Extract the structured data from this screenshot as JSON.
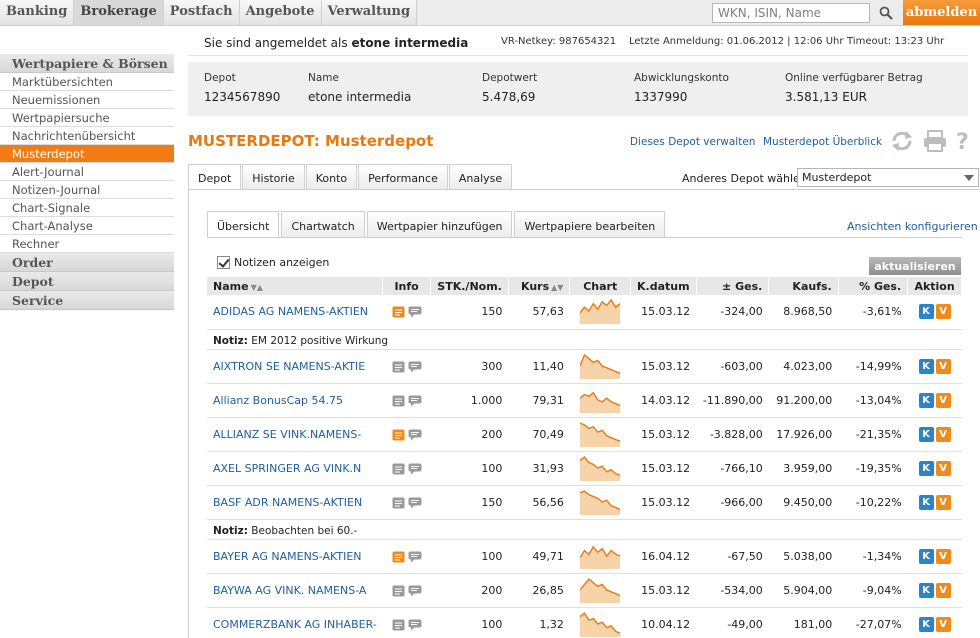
{
  "topnav": {
    "tabs": [
      "Banking",
      "Brokerage",
      "Postfach",
      "Angebote",
      "Verwaltung"
    ],
    "active_index": 1,
    "search_placeholder": "WKN, ISIN, Name",
    "logout_label": "abmelden",
    "accent_color": "#e9780f"
  },
  "sidebar": {
    "section_title": "Wertpapiere & Börsen",
    "items": [
      "Marktübersichten",
      "Neuemissionen",
      "Wertpapiersuche",
      "Nachrichtenübersicht",
      "Musterdepot",
      "Alert-Journal",
      "Notizen-Journal",
      "Chart-Signale",
      "Chart-Analyse",
      "Rechner"
    ],
    "active_index": 4,
    "sections": [
      "Order",
      "Depot",
      "Service"
    ]
  },
  "user": {
    "login_prefix": "Sie sind angemeldet als",
    "login_name": "etone intermedia",
    "netkey": "VR-Netkey: 987654321",
    "last_login": "Letzte Anmeldung: 01.06.2012 | 12:06 Uhr",
    "timeout": "Timeout: 13:23 Uhr"
  },
  "depot_info": {
    "depot_label": "Depot",
    "depot_value": "1234567890",
    "name_label": "Name",
    "name_value": "etone intermedia",
    "depotwert_label": "Depotwert",
    "depotwert_value": "5.478,69",
    "konto_label": "Abwicklungskonto",
    "konto_value": "1337990",
    "betrag_label": "Online verfügbarer Betrag",
    "betrag_value": "3.581,13 EUR"
  },
  "page": {
    "title": "MUSTERDEPOT: Musterdepot",
    "manage_link": "Dieses Depot verwalten",
    "overview_link": "Musterdepot Überblick"
  },
  "tabs_main": [
    "Depot",
    "Historie",
    "Konto",
    "Performance",
    "Analyse"
  ],
  "depot_select": {
    "label": "Anderes Depot wählen:",
    "value": "Musterdepot"
  },
  "tabs_sub": [
    "Übersicht",
    "Chartwatch",
    "Wertpapier hinzufügen",
    "Wertpapiere bearbeiten"
  ],
  "config_link": "Ansichten konfigurieren",
  "notes_toggle_label": "Notizen anzeigen",
  "refresh_label": "aktualisieren",
  "table": {
    "headers": {
      "name": "Name",
      "info": "Info",
      "stk": "STK./Nom.",
      "kurs": "Kurs",
      "chart": "Chart",
      "kdatum": "K.datum",
      "ges": "± Ges.",
      "kaufs": "Kaufs.",
      "pges": "% Ges.",
      "aktion": "Aktion"
    },
    "note_prefix": "Notiz:",
    "action_k": "K",
    "action_v": "V",
    "rows": [
      {
        "name": "ADIDAS AG NAMENS-AKTIEN",
        "stk": "150",
        "kurs": "57,63",
        "kdatum": "15.03.12",
        "ges": "-324,00",
        "kaufs": "8.968,50",
        "pges": "-3,61%",
        "info_orange": true,
        "trend": [
          5,
          8,
          6,
          10,
          7,
          11,
          9,
          12,
          8,
          10
        ],
        "note": "EM 2012 positive Wirkung"
      },
      {
        "name": "AIXTRON SE NAMENS-AKTIE",
        "stk": "300",
        "kurs": "11,40",
        "kdatum": "15.03.12",
        "ges": "-603,00",
        "kaufs": "4.023,00",
        "pges": "-14,99%",
        "info_orange": false,
        "trend": [
          6,
          12,
          10,
          8,
          9,
          6,
          5,
          4,
          3,
          2
        ]
      },
      {
        "name": "Allianz BonusCap 54.75",
        "stk": "1.000",
        "kurs": "79,31",
        "kdatum": "14.03.12",
        "ges": "-11.890,00",
        "kaufs": "91.200,00",
        "pges": "-13,04%",
        "info_orange": false,
        "trend": [
          7,
          9,
          8,
          10,
          6,
          5,
          7,
          5,
          4,
          3
        ]
      },
      {
        "name": "ALLIANZ SE VINK.NAMENS-",
        "stk": "200",
        "kurs": "70,49",
        "kdatum": "15.03.12",
        "ges": "-3.828,00",
        "kaufs": "17.926,00",
        "pges": "-21,35%",
        "info_orange": true,
        "trend": [
          12,
          11,
          9,
          10,
          7,
          8,
          5,
          4,
          3,
          2
        ]
      },
      {
        "name": "AXEL SPRINGER AG VINK.N",
        "stk": "100",
        "kurs": "31,93",
        "kdatum": "15.03.12",
        "ges": "-766,10",
        "kaufs": "3.959,00",
        "pges": "-19,35%",
        "info_orange": false,
        "trend": [
          10,
          12,
          9,
          8,
          6,
          7,
          4,
          5,
          3,
          2
        ]
      },
      {
        "name": "BASF ADR NAMENS-AKTIEN",
        "stk": "150",
        "kurs": "56,56",
        "kdatum": "15.03.12",
        "ges": "-966,00",
        "kaufs": "9.450,00",
        "pges": "-10,22%",
        "info_orange": false,
        "trend": [
          11,
          12,
          10,
          9,
          8,
          6,
          7,
          4,
          3,
          2
        ],
        "note": "Beobachten bei 60.-"
      },
      {
        "name": "BAYER AG NAMENS-AKTIEN",
        "stk": "100",
        "kurs": "49,71",
        "kdatum": "16.04.12",
        "ges": "-67,50",
        "kaufs": "5.038,00",
        "pges": "-1,34%",
        "info_orange": true,
        "trend": [
          5,
          9,
          7,
          11,
          8,
          10,
          6,
          9,
          7,
          6
        ]
      },
      {
        "name": "BAYWA AG VINK. NAMENS-A",
        "stk": "200",
        "kurs": "26,85",
        "kdatum": "15.03.12",
        "ges": "-534,00",
        "kaufs": "5.904,00",
        "pges": "-9,04%",
        "info_orange": false,
        "trend": [
          6,
          9,
          12,
          10,
          8,
          9,
          6,
          5,
          4,
          3
        ]
      },
      {
        "name": "COMMERZBANK AG INHABER-",
        "stk": "100",
        "kurs": "1,32",
        "kdatum": "10.04.12",
        "ges": "-49,00",
        "kaufs": "181,00",
        "pges": "-27,07%",
        "info_orange": false,
        "trend": [
          10,
          12,
          8,
          9,
          6,
          7,
          4,
          5,
          2,
          1
        ]
      }
    ]
  }
}
